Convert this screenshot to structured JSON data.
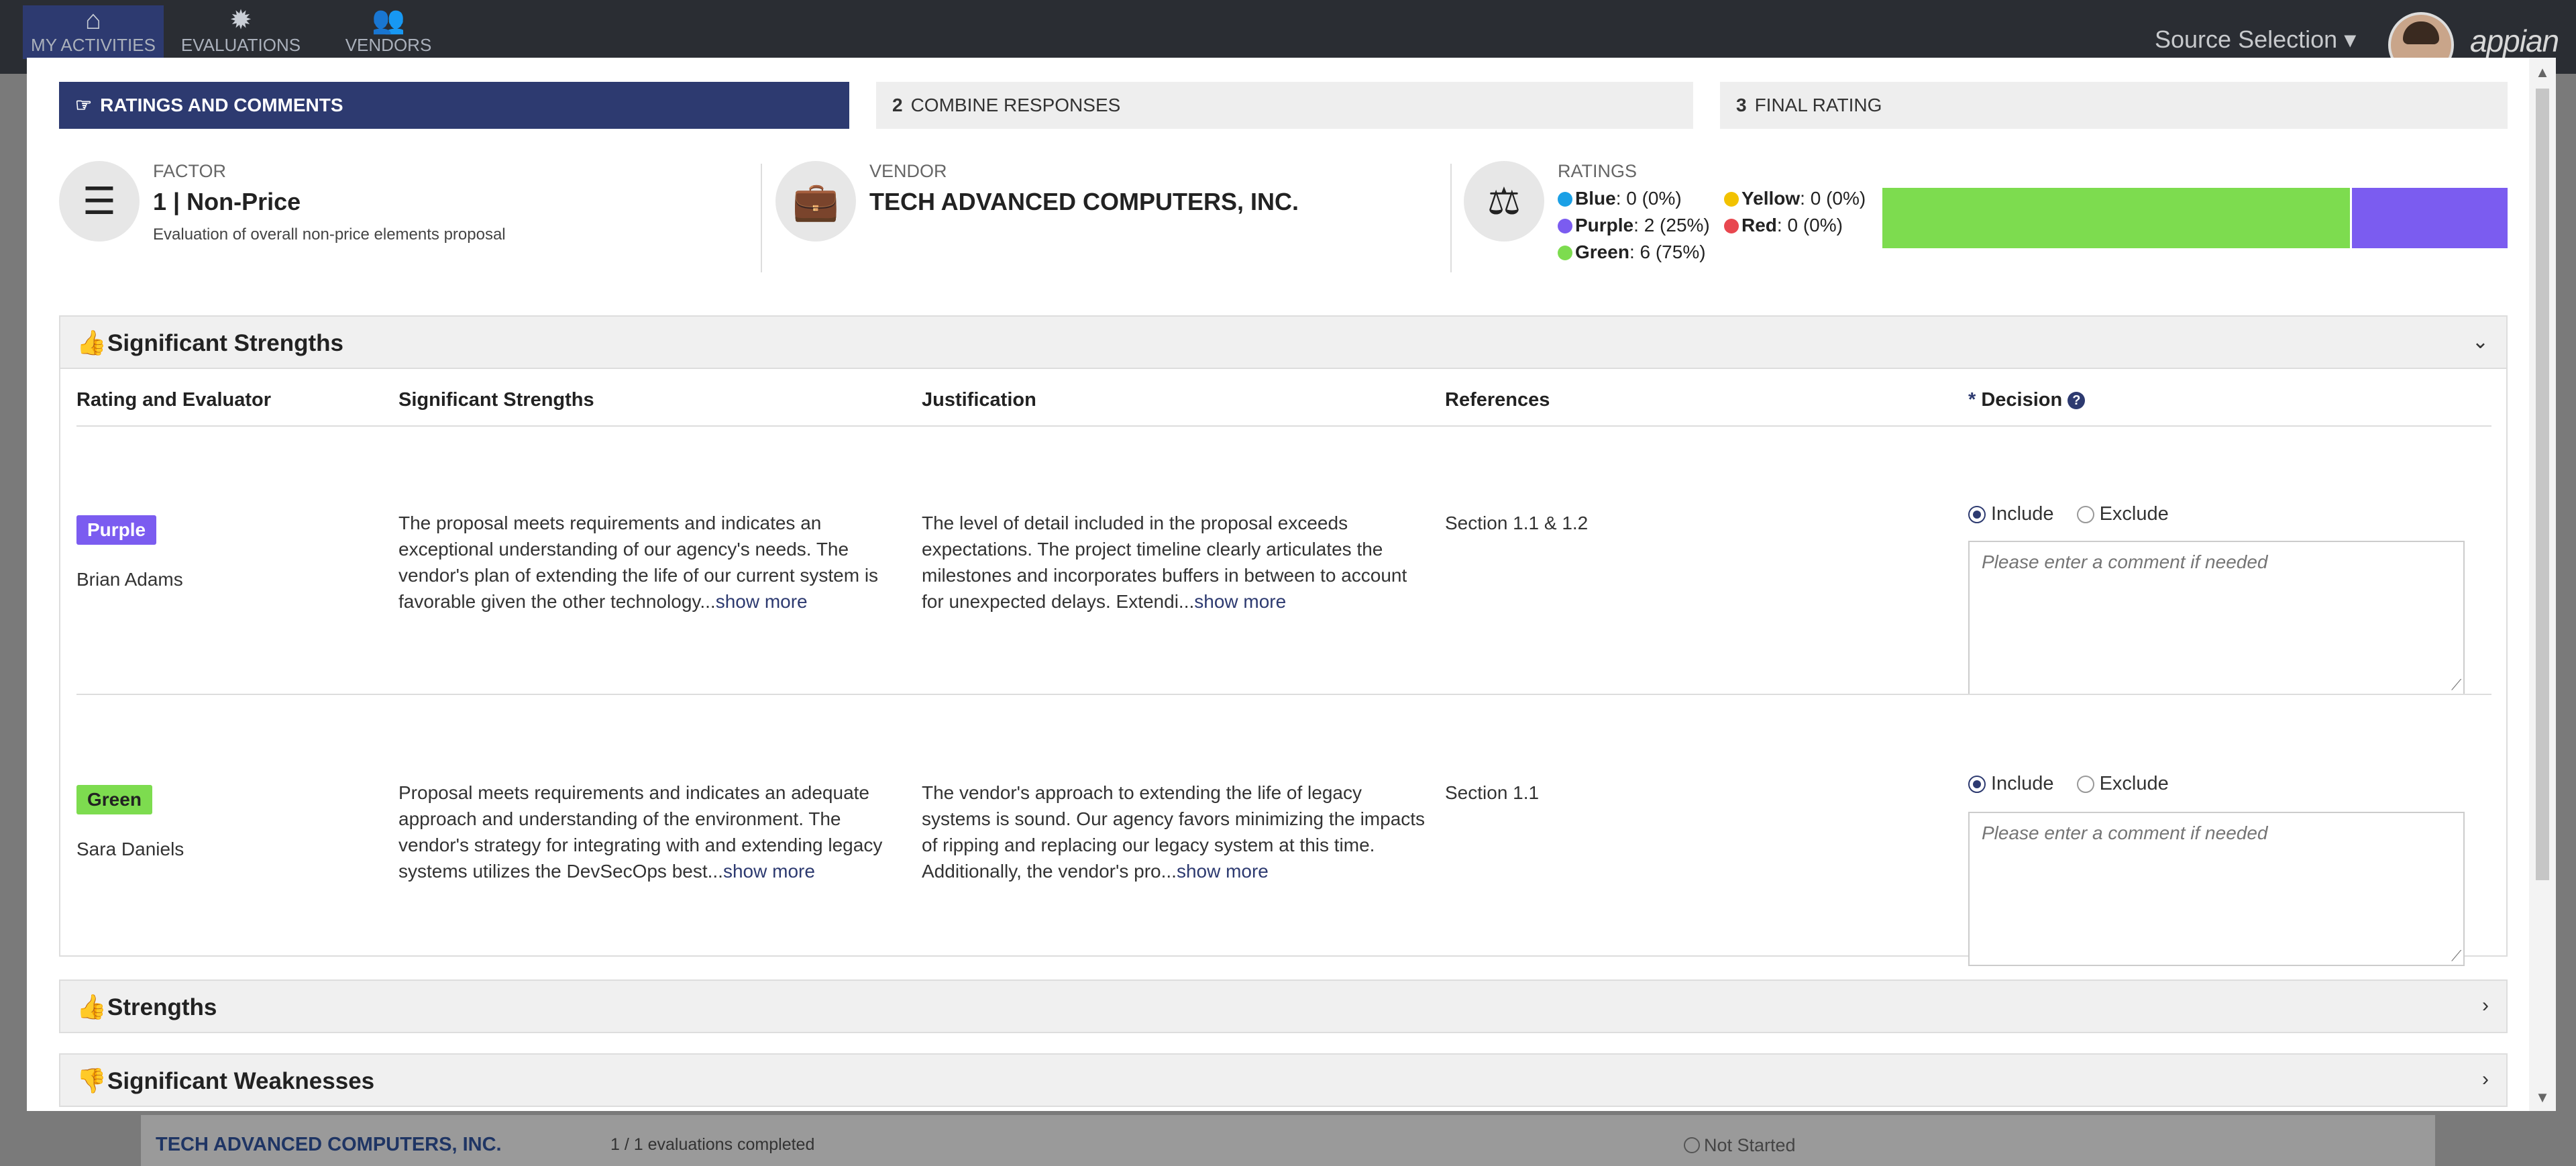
{
  "nav": {
    "items": [
      {
        "label": "MY ACTIVITIES",
        "icon": "home-icon"
      },
      {
        "label": "EVALUATIONS",
        "icon": "gear-icon"
      },
      {
        "label": "VENDORS",
        "icon": "users-icon"
      }
    ],
    "source_selection": "Source Selection",
    "brand": "appian"
  },
  "background_row": {
    "vendor": "TECH ADVANCED COMPUTERS, INC.",
    "evaluations": "1 / 1 evaluations completed",
    "status": "Not Started"
  },
  "steps": [
    {
      "num": "",
      "label": "RATINGS AND COMMENTS"
    },
    {
      "num": "2",
      "label": "COMBINE RESPONSES"
    },
    {
      "num": "3",
      "label": "FINAL RATING"
    }
  ],
  "factor": {
    "label": "FACTOR",
    "title": "1 | Non-Price",
    "description": "Evaluation of overall non-price elements proposal"
  },
  "vendor": {
    "label": "VENDOR",
    "name": "TECH ADVANCED COMPUTERS, INC."
  },
  "ratings": {
    "label": "RATINGS",
    "items": [
      {
        "name": "Blue",
        "value": ": 0 (0%)",
        "color": "#1aa0e6"
      },
      {
        "name": "Yellow",
        "value": ": 0 (0%)",
        "color": "#f2c200"
      },
      {
        "name": "Purple",
        "value": ": 2 (25%)",
        "color": "#7b5cf0"
      },
      {
        "name": "Red",
        "value": ": 0 (0%)",
        "color": "#e8474f"
      },
      {
        "name": "Green",
        "value": ": 6 (75%)",
        "color": "#7ddc4f"
      }
    ],
    "bar": {
      "green_fraction": 0.75,
      "purple_fraction": 0.25
    }
  },
  "sections": {
    "significant_strengths": "Significant Strengths",
    "strengths": "Strengths",
    "significant_weaknesses": "Significant Weaknesses"
  },
  "table": {
    "headers": {
      "rating": "Rating and Evaluator",
      "strengths": "Significant Strengths",
      "justification": "Justification",
      "references": "References",
      "decision_req": "*",
      "decision": "Decision"
    },
    "include_label": "Include",
    "exclude_label": "Exclude",
    "comment_placeholder": "Please enter a comment if needed",
    "show_more": "show more",
    "rows": [
      {
        "rating": "Purple",
        "evaluator": "Brian Adams",
        "strength": "The proposal meets requirements and indicates an exceptional understanding of our agency's needs. The vendor's plan of extending the life of our current system is favorable given the other technology...",
        "justification": "The level of detail included in the proposal exceeds expectations. The project timeline clearly articulates the milestones and incorporates buffers in between to account for unexpected delays. Extendi...",
        "references": "Section 1.1 & 1.2",
        "decision": "Include"
      },
      {
        "rating": "Green",
        "evaluator": "Sara Daniels",
        "strength": "Proposal meets requirements and indicates an adequate approach and understanding of the environment. The vendor's strategy for integrating with and extending legacy systems utilizes the DevSecOps best...",
        "justification": "The vendor's approach to extending the life of legacy systems is sound. Our agency favors minimizing the impacts of ripping and replacing our legacy system at this time. Additionally, the vendor's pro...",
        "references": "Section 1.1",
        "decision": "Include"
      }
    ]
  }
}
